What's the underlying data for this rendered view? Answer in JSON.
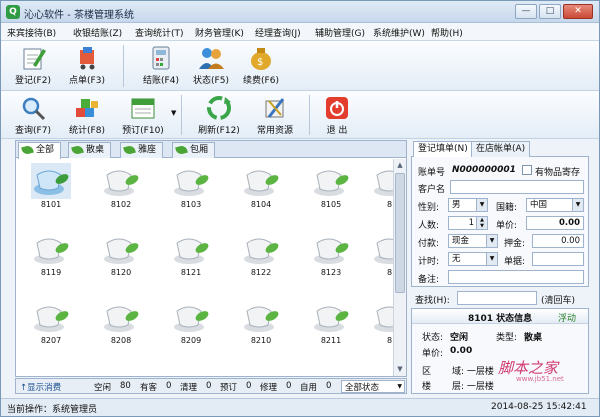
{
  "window": {
    "title": "沁心软件 - 茶楼管理系统",
    "minimize": "—",
    "maximize": "□",
    "close": "✕"
  },
  "menu": [
    "来宾接待(B)",
    "收银结账(Z)",
    "查询统计(T)",
    "财务管理(K)",
    "经理查询(J)",
    "辅助管理(G)",
    "系统维护(W)",
    "帮助(H)"
  ],
  "toolbar1": [
    {
      "label": "登记(F2)",
      "icon": "pencil-paper-icon"
    },
    {
      "label": "点单(F3)",
      "icon": "cart-icon"
    },
    {
      "label": "结账(F4)",
      "icon": "calculator-icon"
    },
    {
      "label": "状态(F5)",
      "icon": "status-people-icon"
    },
    {
      "label": "续费(F6)",
      "icon": "money-bag-icon"
    }
  ],
  "toolbar2": [
    {
      "label": "查询(F7)",
      "icon": "magnifier-icon"
    },
    {
      "label": "统计(F8)",
      "icon": "cubes-icon"
    },
    {
      "label": "预订(F10)",
      "icon": "calendar-icon"
    },
    {
      "label": "刷新(F12)",
      "icon": "recycle-icon"
    },
    {
      "label": "常用资源",
      "icon": "tools-icon"
    },
    {
      "label": "退 出",
      "icon": "exit-icon"
    }
  ],
  "tabs": [
    "全部",
    "散桌",
    "雅座",
    "包厢"
  ],
  "tables": {
    "row1": [
      "8101",
      "8102",
      "8103",
      "8104",
      "8105",
      "8"
    ],
    "row2": [
      "8119",
      "8120",
      "8121",
      "8122",
      "8123",
      "8"
    ],
    "row3": [
      "8207",
      "8208",
      "8209",
      "8210",
      "8211",
      "8"
    ]
  },
  "bottom_bar": {
    "toggle": "↑显示消费",
    "free_label": "空闲",
    "free": "80",
    "occupied_label": "有客",
    "occupied": "0",
    "cleaning_label": "清理",
    "cleaning": "0",
    "reserved_label": "预订",
    "reserved": "0",
    "repair_label": "修理",
    "repair": "0",
    "self_label": "自用",
    "self": "0",
    "status_filter": "全部状态"
  },
  "statusbar": {
    "operator": "当前操作：系统管理员",
    "datetime": "2014-08-25 15:42:41"
  },
  "right_tabs": [
    "登记填单(N)",
    "在店帐单(A)"
  ],
  "form": {
    "bill_no_label": "账单号",
    "bill_no": "N000000001",
    "goods_label": "有物品寄存",
    "guest_label": "客户名",
    "gender_label": "性别:",
    "gender": "男",
    "nation_label": "国籍:",
    "nation": "中国",
    "people_label": "人数:",
    "people": "1",
    "price_label": "单价:",
    "price": "0.00",
    "pay_label": "付款:",
    "pay": "现金",
    "deposit_label": "押金:",
    "deposit": "0.00",
    "timing_label": "计时:",
    "timing": "无",
    "receipt_label": "单据:",
    "note_label": "备注:"
  },
  "search": {
    "label": "查找(H):",
    "clear": "(清回车)"
  },
  "info": {
    "title": "8101 状态信息",
    "float": "浮动",
    "status_label": "状态:",
    "status": "空闲",
    "type_label": "类型:",
    "type": "散桌",
    "price_label": "单价:",
    "price": "0.00",
    "area_label": "区",
    "area": "域: 一层楼",
    "floor_label": "楼",
    "floor": "层: 一层楼"
  },
  "watermark": {
    "main": "脚本之家",
    "url": "www.jb51.net"
  }
}
